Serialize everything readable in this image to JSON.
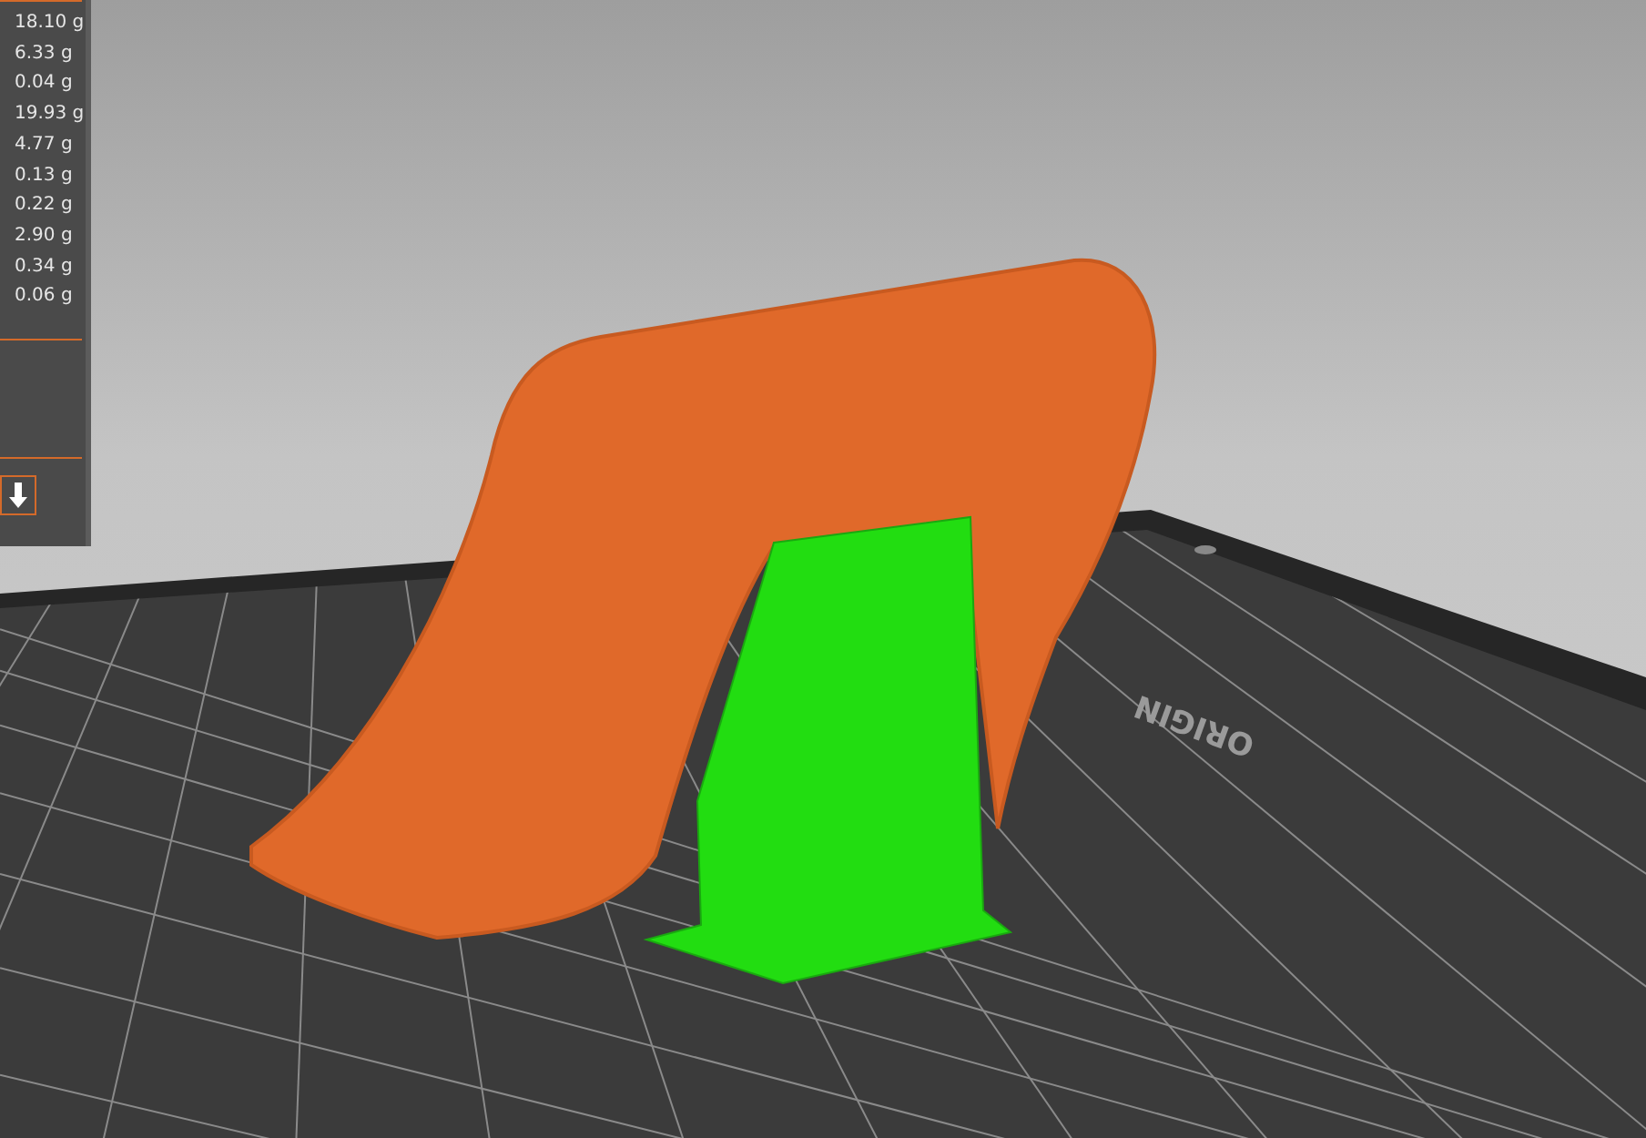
{
  "sidebar": {
    "weights": [
      "18.10 g",
      "6.33 g",
      "0.04 g",
      "19.93 g",
      "4.77 g",
      "0.13 g",
      "0.22 g",
      "2.90 g",
      "0.34 g",
      "0.06 g"
    ]
  },
  "scene": {
    "bed_label": "ORIGIN"
  }
}
